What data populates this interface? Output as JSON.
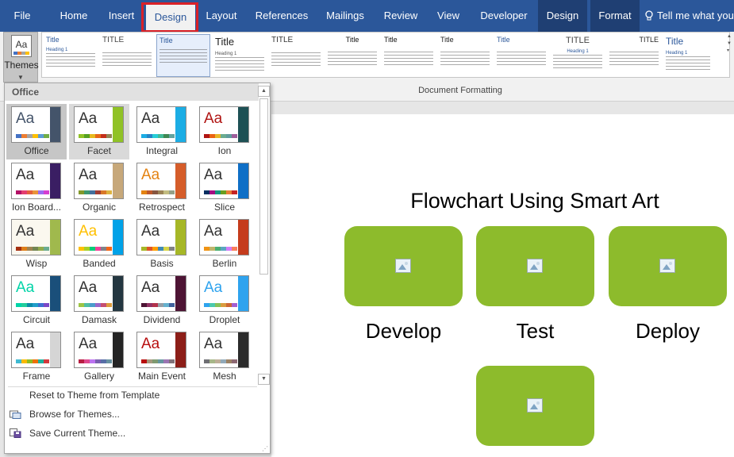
{
  "tabs": [
    {
      "label": "File",
      "active": false
    },
    {
      "label": "Home",
      "active": false
    },
    {
      "label": "Insert",
      "active": false
    },
    {
      "label": "Design",
      "active": true
    },
    {
      "label": "Layout",
      "active": false
    },
    {
      "label": "References",
      "active": false
    },
    {
      "label": "Mailings",
      "active": false
    },
    {
      "label": "Review",
      "active": false
    },
    {
      "label": "View",
      "active": false
    },
    {
      "label": "Developer",
      "active": false
    },
    {
      "label": "Design",
      "active": false,
      "contextual": true
    },
    {
      "label": "Format",
      "active": false,
      "contextual": true
    }
  ],
  "tell_me": "Tell me what you",
  "ribbon": {
    "themes_label": "Themes",
    "group_label": "Document Formatting",
    "style_titles": [
      "Title",
      "TITLE",
      "Title",
      "Title",
      "TITLE",
      "Title",
      "Title",
      "Title",
      "Title",
      "TITLE",
      "TITLE",
      "Title"
    ],
    "style_heading": "Heading 1"
  },
  "themes_menu": {
    "header": "Office",
    "themes": [
      {
        "name": "Office",
        "bg": "#ffffff",
        "accent": "#44546a",
        "sw": [
          "#4472c4",
          "#ed7d31",
          "#a5a5a5",
          "#ffc000",
          "#5b9bd5",
          "#70ad47"
        ]
      },
      {
        "name": "Facet",
        "bg": "#ffffff",
        "accent": "#90c226",
        "sw": [
          "#90c226",
          "#54a021",
          "#e6b91e",
          "#e76618",
          "#c42f1a",
          "#918655"
        ]
      },
      {
        "name": "Integral",
        "bg": "#ffffff",
        "accent": "#1cade4",
        "sw": [
          "#1cade4",
          "#2683c6",
          "#27ced7",
          "#42ba97",
          "#3e8853",
          "#62a39f"
        ]
      },
      {
        "name": "Ion",
        "bg": "#ffffff",
        "accent": "#1e5155",
        "sw": [
          "#b01513",
          "#ea6312",
          "#e6b729",
          "#6aac90",
          "#5f9c9d",
          "#9e5e9b"
        ]
      },
      {
        "name": "Ion Boardroom",
        "bg": "#ffffff",
        "accent": "#3a1e63",
        "sw": [
          "#b31166",
          "#e33d6f",
          "#e45f3c",
          "#e9943a",
          "#9b6bf2",
          "#d53dd0"
        ]
      },
      {
        "name": "Organic",
        "bg": "#ffffff",
        "accent": "#c7a87a",
        "sw": [
          "#83992a",
          "#3c9770",
          "#44709d",
          "#a23c33",
          "#d97828",
          "#deb340"
        ]
      },
      {
        "name": "Retrospect",
        "bg": "#ffffff",
        "accent": "#d55d2a",
        "sw": [
          "#e48312",
          "#bd582c",
          "#865640",
          "#9b8357",
          "#c2bc80",
          "#94a088"
        ]
      },
      {
        "name": "Slice",
        "bg": "#ffffff",
        "accent": "#0f6fc6",
        "sw": [
          "#052f61",
          "#a50e82",
          "#14967c",
          "#6a9e1f",
          "#e87d37",
          "#c62324"
        ]
      },
      {
        "name": "Wisp",
        "bg": "#fbf8ef",
        "accent": "#a0b94d",
        "sw": [
          "#a53010",
          "#de7e18",
          "#9f8351",
          "#728653",
          "#92aa4c",
          "#6aac91"
        ]
      },
      {
        "name": "Banded",
        "bg": "#ffffff",
        "accent": "#00a2e8",
        "sw": [
          "#ffc000",
          "#a5d028",
          "#08cc78",
          "#f24099",
          "#828288",
          "#f56617"
        ]
      },
      {
        "name": "Basis",
        "bg": "#ffffff",
        "accent": "#a6b727",
        "sw": [
          "#a6b727",
          "#df5327",
          "#fe9e00",
          "#418ab3",
          "#d7d447",
          "#818183"
        ]
      },
      {
        "name": "Berlin",
        "bg": "#ffffff",
        "accent": "#c53c1d",
        "sw": [
          "#f09415",
          "#c1b56b",
          "#4baf73",
          "#5aa6c0",
          "#d17df9",
          "#fa7e5c"
        ]
      },
      {
        "name": "Circuit",
        "bg": "#ffffff",
        "accent": "#1a4f7a",
        "sw": [
          "#03d4a8",
          "#21cd9c",
          "#0b8aa8",
          "#1f9ec9",
          "#3f6ed1",
          "#7b47c6"
        ]
      },
      {
        "name": "Damask",
        "bg": "#ffffff",
        "accent": "#243741",
        "sw": [
          "#9ec544",
          "#50bea3",
          "#4a9ccc",
          "#9a66ca",
          "#c54f71",
          "#de9c3c"
        ]
      },
      {
        "name": "Dividend",
        "bg": "#ffffff",
        "accent": "#4d1434",
        "sw": [
          "#4d1434",
          "#903163",
          "#b2324b",
          "#969fa7",
          "#66b1ce",
          "#40619d"
        ]
      },
      {
        "name": "Droplet",
        "bg": "#ffffff",
        "accent": "#2fa3ee",
        "sw": [
          "#2fa3ee",
          "#4bcaad",
          "#86c157",
          "#d99c3f",
          "#ce6633",
          "#a35dd1"
        ]
      },
      {
        "name": "Frame",
        "bg": "#ffffff",
        "accent": "#d5d5d5",
        "sw": [
          "#40bad2",
          "#fab900",
          "#90bb23",
          "#ee7008",
          "#1ab39f",
          "#d5393d"
        ]
      },
      {
        "name": "Gallery",
        "bg": "#ffffff",
        "accent": "#242424",
        "sw": [
          "#b71e42",
          "#de478e",
          "#bc72f0",
          "#795faf",
          "#586ea6",
          "#6892a0"
        ]
      },
      {
        "name": "Main Event",
        "bg": "#ffffff",
        "accent": "#8c1e18",
        "sw": [
          "#b80e0f",
          "#a6987d",
          "#7f9a71",
          "#64969f",
          "#9b75b2",
          "#80737a"
        ]
      },
      {
        "name": "Mesh",
        "bg": "#ffffff",
        "accent": "#2b2b2b",
        "sw": [
          "#6f6f74",
          "#a7b789",
          "#beae98",
          "#92a9b9",
          "#9c8265",
          "#8d6974"
        ]
      }
    ],
    "reset_label": "Reset to Theme from Template",
    "browse_label": "Browse for Themes...",
    "save_label": "Save Current Theme..."
  },
  "document": {
    "title": "Flowchart Using Smart Art",
    "boxes": [
      {
        "label": "Develop"
      },
      {
        "label": "Test"
      },
      {
        "label": "Deploy"
      }
    ],
    "box_color": "#8dbb2c"
  }
}
